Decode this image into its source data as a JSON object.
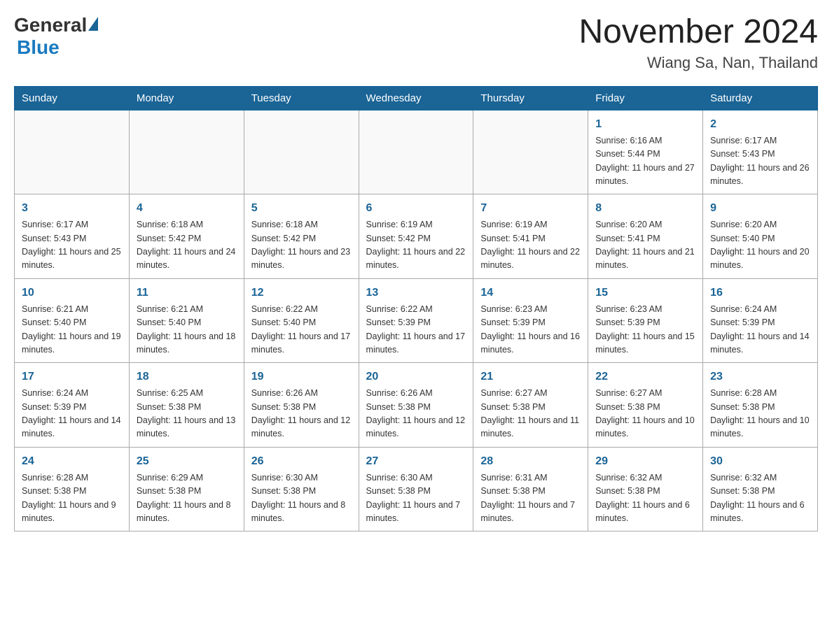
{
  "header": {
    "logo_text_general": "General",
    "logo_text_blue": "Blue",
    "month_title": "November 2024",
    "location": "Wiang Sa, Nan, Thailand"
  },
  "days_of_week": [
    "Sunday",
    "Monday",
    "Tuesday",
    "Wednesday",
    "Thursday",
    "Friday",
    "Saturday"
  ],
  "weeks": [
    [
      {
        "day": "",
        "info": ""
      },
      {
        "day": "",
        "info": ""
      },
      {
        "day": "",
        "info": ""
      },
      {
        "day": "",
        "info": ""
      },
      {
        "day": "",
        "info": ""
      },
      {
        "day": "1",
        "info": "Sunrise: 6:16 AM\nSunset: 5:44 PM\nDaylight: 11 hours and 27 minutes."
      },
      {
        "day": "2",
        "info": "Sunrise: 6:17 AM\nSunset: 5:43 PM\nDaylight: 11 hours and 26 minutes."
      }
    ],
    [
      {
        "day": "3",
        "info": "Sunrise: 6:17 AM\nSunset: 5:43 PM\nDaylight: 11 hours and 25 minutes."
      },
      {
        "day": "4",
        "info": "Sunrise: 6:18 AM\nSunset: 5:42 PM\nDaylight: 11 hours and 24 minutes."
      },
      {
        "day": "5",
        "info": "Sunrise: 6:18 AM\nSunset: 5:42 PM\nDaylight: 11 hours and 23 minutes."
      },
      {
        "day": "6",
        "info": "Sunrise: 6:19 AM\nSunset: 5:42 PM\nDaylight: 11 hours and 22 minutes."
      },
      {
        "day": "7",
        "info": "Sunrise: 6:19 AM\nSunset: 5:41 PM\nDaylight: 11 hours and 22 minutes."
      },
      {
        "day": "8",
        "info": "Sunrise: 6:20 AM\nSunset: 5:41 PM\nDaylight: 11 hours and 21 minutes."
      },
      {
        "day": "9",
        "info": "Sunrise: 6:20 AM\nSunset: 5:40 PM\nDaylight: 11 hours and 20 minutes."
      }
    ],
    [
      {
        "day": "10",
        "info": "Sunrise: 6:21 AM\nSunset: 5:40 PM\nDaylight: 11 hours and 19 minutes."
      },
      {
        "day": "11",
        "info": "Sunrise: 6:21 AM\nSunset: 5:40 PM\nDaylight: 11 hours and 18 minutes."
      },
      {
        "day": "12",
        "info": "Sunrise: 6:22 AM\nSunset: 5:40 PM\nDaylight: 11 hours and 17 minutes."
      },
      {
        "day": "13",
        "info": "Sunrise: 6:22 AM\nSunset: 5:39 PM\nDaylight: 11 hours and 17 minutes."
      },
      {
        "day": "14",
        "info": "Sunrise: 6:23 AM\nSunset: 5:39 PM\nDaylight: 11 hours and 16 minutes."
      },
      {
        "day": "15",
        "info": "Sunrise: 6:23 AM\nSunset: 5:39 PM\nDaylight: 11 hours and 15 minutes."
      },
      {
        "day": "16",
        "info": "Sunrise: 6:24 AM\nSunset: 5:39 PM\nDaylight: 11 hours and 14 minutes."
      }
    ],
    [
      {
        "day": "17",
        "info": "Sunrise: 6:24 AM\nSunset: 5:39 PM\nDaylight: 11 hours and 14 minutes."
      },
      {
        "day": "18",
        "info": "Sunrise: 6:25 AM\nSunset: 5:38 PM\nDaylight: 11 hours and 13 minutes."
      },
      {
        "day": "19",
        "info": "Sunrise: 6:26 AM\nSunset: 5:38 PM\nDaylight: 11 hours and 12 minutes."
      },
      {
        "day": "20",
        "info": "Sunrise: 6:26 AM\nSunset: 5:38 PM\nDaylight: 11 hours and 12 minutes."
      },
      {
        "day": "21",
        "info": "Sunrise: 6:27 AM\nSunset: 5:38 PM\nDaylight: 11 hours and 11 minutes."
      },
      {
        "day": "22",
        "info": "Sunrise: 6:27 AM\nSunset: 5:38 PM\nDaylight: 11 hours and 10 minutes."
      },
      {
        "day": "23",
        "info": "Sunrise: 6:28 AM\nSunset: 5:38 PM\nDaylight: 11 hours and 10 minutes."
      }
    ],
    [
      {
        "day": "24",
        "info": "Sunrise: 6:28 AM\nSunset: 5:38 PM\nDaylight: 11 hours and 9 minutes."
      },
      {
        "day": "25",
        "info": "Sunrise: 6:29 AM\nSunset: 5:38 PM\nDaylight: 11 hours and 8 minutes."
      },
      {
        "day": "26",
        "info": "Sunrise: 6:30 AM\nSunset: 5:38 PM\nDaylight: 11 hours and 8 minutes."
      },
      {
        "day": "27",
        "info": "Sunrise: 6:30 AM\nSunset: 5:38 PM\nDaylight: 11 hours and 7 minutes."
      },
      {
        "day": "28",
        "info": "Sunrise: 6:31 AM\nSunset: 5:38 PM\nDaylight: 11 hours and 7 minutes."
      },
      {
        "day": "29",
        "info": "Sunrise: 6:32 AM\nSunset: 5:38 PM\nDaylight: 11 hours and 6 minutes."
      },
      {
        "day": "30",
        "info": "Sunrise: 6:32 AM\nSunset: 5:38 PM\nDaylight: 11 hours and 6 minutes."
      }
    ]
  ]
}
